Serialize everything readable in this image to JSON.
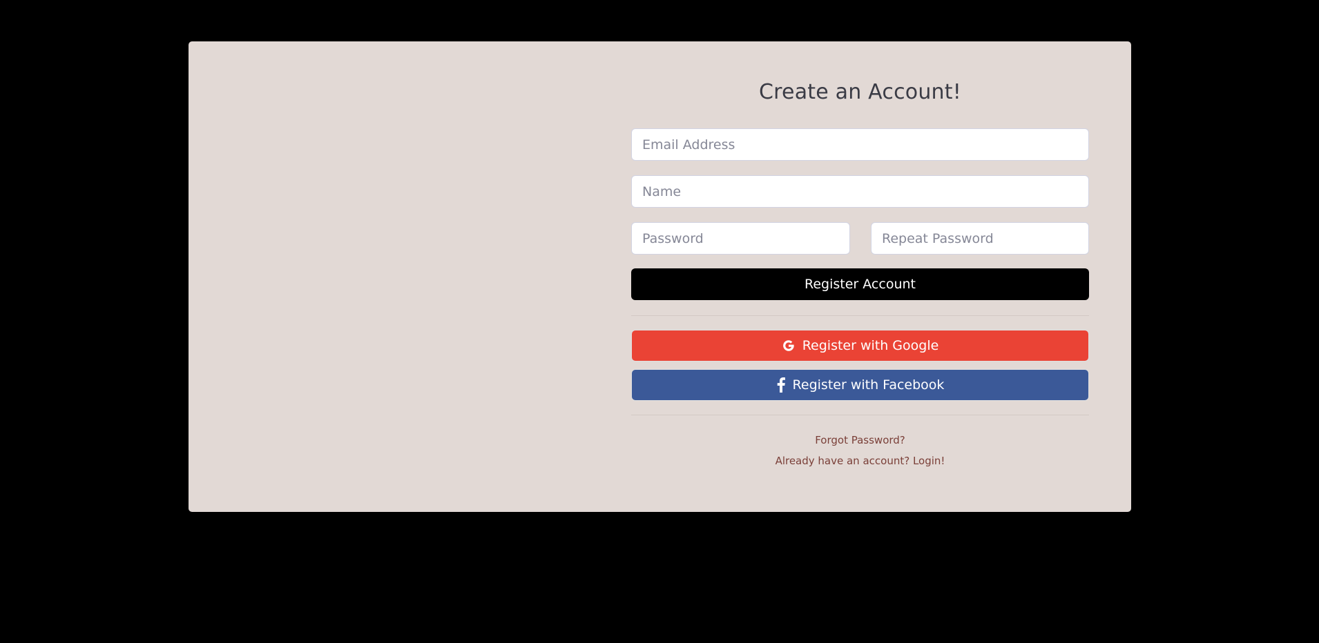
{
  "register": {
    "title": "Create an Account!",
    "email_placeholder": "Email Address",
    "name_placeholder": "Name",
    "password_placeholder": "Password",
    "repeat_password_placeholder": "Repeat Password",
    "register_button": "Register Account",
    "google_button": "Register with Google",
    "facebook_button": "Register with Facebook",
    "forgot_password_link": "Forgot Password?",
    "login_link": "Already have an account? Login!"
  },
  "colors": {
    "background": "#000000",
    "card": "#e2d9d5",
    "register_button": "#000000",
    "google": "#ea4335",
    "facebook": "#3b5998",
    "link": "#7a3f38"
  },
  "icons": {
    "google": "google-icon",
    "facebook": "facebook-icon"
  }
}
